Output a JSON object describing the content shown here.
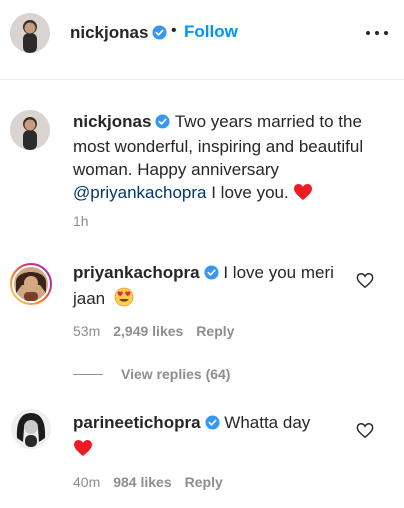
{
  "post": {
    "author": "nickjonas",
    "follow_label": "Follow",
    "separator": "•"
  },
  "caption": {
    "username": "nickjonas",
    "text_part1": "Two years married to the most wonderful, inspiring and beautiful woman. Happy anniversary",
    "mention": "@priyankachopra",
    "text_part2": "I love you.",
    "time": "1h"
  },
  "comments": [
    {
      "username": "priyankachopra",
      "text": "I love you meri jaan",
      "time": "53m",
      "likes": "2,949 likes",
      "reply_label": "Reply",
      "view_replies": "View replies (64)"
    },
    {
      "username": "parineetichopra",
      "text": "Whatta day",
      "time": "40m",
      "likes": "984 likes",
      "reply_label": "Reply"
    }
  ],
  "colors": {
    "link_blue": "#0095f6",
    "mention_blue": "#00376b",
    "verified_blue": "#3897f0",
    "heart_red": "#ed1c24",
    "secondary_text": "#8e8e8e"
  },
  "icons": [
    "verified-badge-icon",
    "more-options-icon",
    "heart-outline-icon",
    "red-heart-emoji",
    "heart-eyes-emoji"
  ]
}
